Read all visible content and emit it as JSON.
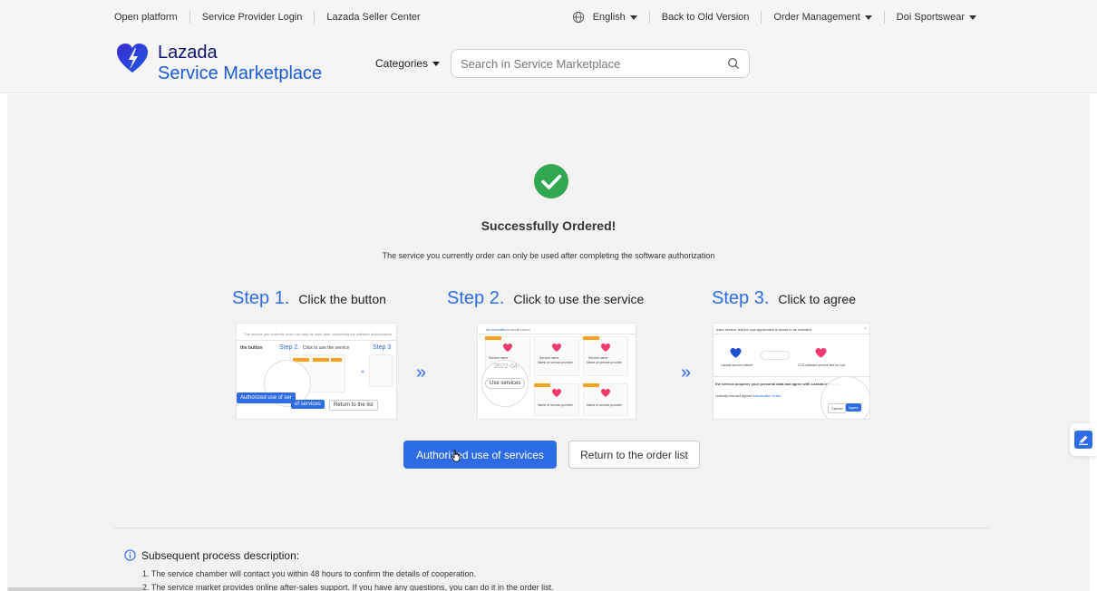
{
  "topbar": {
    "links": [
      "Open platform",
      "Service Provider Login",
      "Lazada Seller Center"
    ],
    "language": "English",
    "back_old": "Back to Old Version",
    "order_mgmt": "Order Management",
    "account": "Doi Sportswear"
  },
  "header": {
    "brand_line1": "Lazada",
    "brand_line2": "Service Marketplace",
    "categories": "Categories",
    "search_placeholder": "Search in Service Marketplace"
  },
  "result": {
    "title": "Successfully Ordered!",
    "subtitle": "The service you currently order can only be used after completing the software authorization"
  },
  "steps": [
    {
      "num": "Step 1.",
      "text": "Click the button"
    },
    {
      "num": "Step 2.",
      "text": "Click to use the service"
    },
    {
      "num": "Step 3.",
      "text": "Click to agree"
    }
  ],
  "illus": {
    "s1_header": "The service you currently order can only be used after completing the software authorization",
    "s1_label": "the button",
    "s1_step2": "Step 2.",
    "s1_step2_text": "Click to use the service",
    "s1_step3": "Step 3",
    "s1_auth": "Authorized use of ser",
    "s1_services": "of services",
    "s1_return": "Return to the list",
    "s2_tab1": "All services",
    "s2_tab2": "Purchased",
    "s2_tab3": "Expired",
    "s2_date": "2022-04-",
    "s2_use": "Use services",
    "s2_name": "Service name",
    "s2_provider": "Name of service provider",
    "s3_header": "ware service test for cyw application is about to be installed",
    "s3_left": "Lazada service market",
    "s3_right": "CCS software service test for cyw",
    "s3_consent": "the service acquires your personal data and agree with Lazada to transf",
    "s3_link": "currently read and agreed",
    "s3_link2": "Authorization Notice",
    "s3_cancel": "Cancel",
    "s3_agree": "Agree"
  },
  "arrows": "»",
  "buttons": {
    "authorize": "Authorized use of services",
    "return": "Return to the order list"
  },
  "process": {
    "title": "Subsequent process description:",
    "item1": "1. The service chamber will contact you within 48 hours to confirm the details of cooperation.",
    "item2": "2. The service market provides online after-sales support. If you have any questions, you can do it in the order list."
  },
  "colors": {
    "accent": "#2d6ce5",
    "success": "#2fa84f",
    "brand_dark": "#0f136d",
    "lazada_pink": "#f23a6f",
    "lazada_orange": "#f7a21b"
  }
}
